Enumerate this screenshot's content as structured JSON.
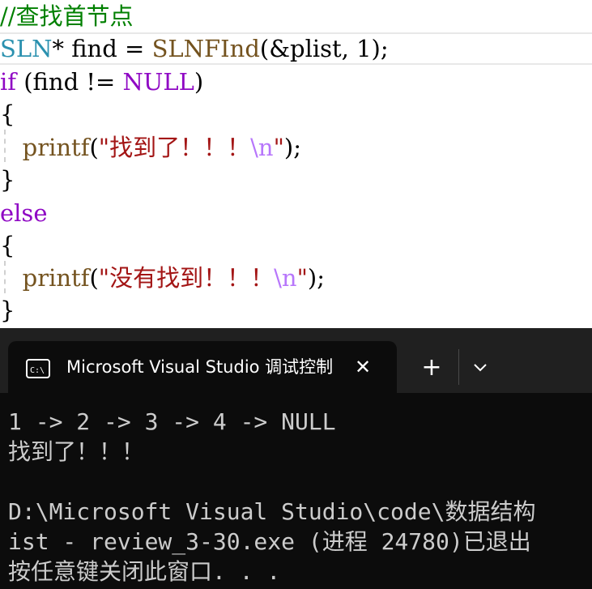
{
  "editor": {
    "lines": [
      [
        {
          "t": "//查找首节点",
          "c": "cm"
        }
      ],
      [
        {
          "t": "SLN",
          "c": "ty"
        },
        {
          "t": "* ",
          "c": "pl"
        },
        {
          "t": "find",
          "c": "pl"
        },
        {
          "t": " = ",
          "c": "pl"
        },
        {
          "t": "SLNFInd",
          "c": "fn"
        },
        {
          "t": "(&plist, 1);",
          "c": "pl"
        }
      ],
      [
        {
          "t": "if",
          "c": "kw"
        },
        {
          "t": " (find != ",
          "c": "pl"
        },
        {
          "t": "NULL",
          "c": "mac"
        },
        {
          "t": ")",
          "c": "pl"
        }
      ],
      [
        {
          "t": "{",
          "c": "pl"
        }
      ],
      [
        {
          "t": "   ",
          "c": "pl"
        },
        {
          "t": "printf",
          "c": "fn"
        },
        {
          "t": "(",
          "c": "pl"
        },
        {
          "t": "\"找到了！！！",
          "c": "st"
        },
        {
          "t": "\\n",
          "c": "esc"
        },
        {
          "t": "\"",
          "c": "st"
        },
        {
          "t": ");",
          "c": "pl"
        }
      ],
      [
        {
          "t": "}",
          "c": "pl"
        }
      ],
      [
        {
          "t": "else",
          "c": "kw"
        }
      ],
      [
        {
          "t": "{",
          "c": "pl"
        }
      ],
      [
        {
          "t": "   ",
          "c": "pl"
        },
        {
          "t": "printf",
          "c": "fn"
        },
        {
          "t": "(",
          "c": "pl"
        },
        {
          "t": "\"没有找到！！！",
          "c": "st"
        },
        {
          "t": "\\n",
          "c": "esc"
        },
        {
          "t": "\"",
          "c": "st"
        },
        {
          "t": ");",
          "c": "pl"
        }
      ],
      [
        {
          "t": "}",
          "c": "pl"
        }
      ]
    ]
  },
  "terminal": {
    "tab_title": "Microsoft Visual Studio 调试控制台",
    "close_glyph": "✕",
    "new_tab_glyph": "+",
    "output": [
      "1 -> 2 -> 3 -> 4 -> NULL",
      "找到了！！！",
      "",
      "D:\\Microsoft Visual Studio\\code\\数据结构",
      "ist - review_3-30.exe (进程 24780)已退出",
      "按任意键关闭此窗口. . ."
    ],
    "colors": {
      "background": "#0c0c0c",
      "tabbar": "#202020",
      "text": "#cccccc"
    }
  }
}
